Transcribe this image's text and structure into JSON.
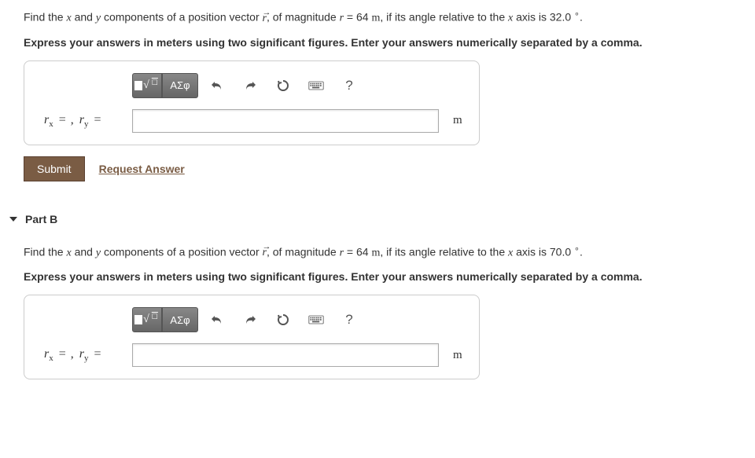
{
  "partA": {
    "question_pre": "Find the ",
    "q_x": "x",
    "q_and": " and ",
    "q_y": "y",
    "q_comp": " components of a position vector ",
    "q_r": "r",
    "q_mag": ", of magnitude ",
    "q_req": "r",
    "q_eqval": " = 64 ",
    "q_munit": "m",
    "q_angletxt": ", if its angle relative to the ",
    "q_x2": "x",
    "q_axis": " axis is 32.0 ",
    "q_deg": "∘",
    "q_dot": ".",
    "instruction": "Express your answers in meters using two significant figures. Enter your answers numerically separated by a comma.",
    "lhs_rx": "r",
    "lhs_subx": "x",
    "lhs_eq1": "=",
    "lhs_comma": ", ",
    "lhs_ry": "r",
    "lhs_suby": "y",
    "lhs_eq2": "=",
    "unit": "m",
    "input_value": ""
  },
  "toolbar": {
    "greek": "ΑΣφ",
    "help": "?"
  },
  "buttons": {
    "submit": "Submit",
    "request": "Request Answer"
  },
  "partB": {
    "header": "Part B",
    "question_pre": "Find the ",
    "q_x": "x",
    "q_and": " and ",
    "q_y": "y",
    "q_comp": " components of a position vector ",
    "q_r": "r",
    "q_mag": ", of magnitude ",
    "q_req": "r",
    "q_eqval": " = 64 ",
    "q_munit": "m",
    "q_angletxt": ", if its angle relative to the ",
    "q_x2": "x",
    "q_axis": " axis is 70.0 ",
    "q_deg": "∘",
    "q_dot": ".",
    "instruction": "Express your answers in meters using two significant figures. Enter your answers numerically separated by a comma.",
    "lhs_rx": "r",
    "lhs_subx": "x",
    "lhs_eq1": "=",
    "lhs_comma": ", ",
    "lhs_ry": "r",
    "lhs_suby": "y",
    "lhs_eq2": "=",
    "unit": "m",
    "input_value": ""
  }
}
